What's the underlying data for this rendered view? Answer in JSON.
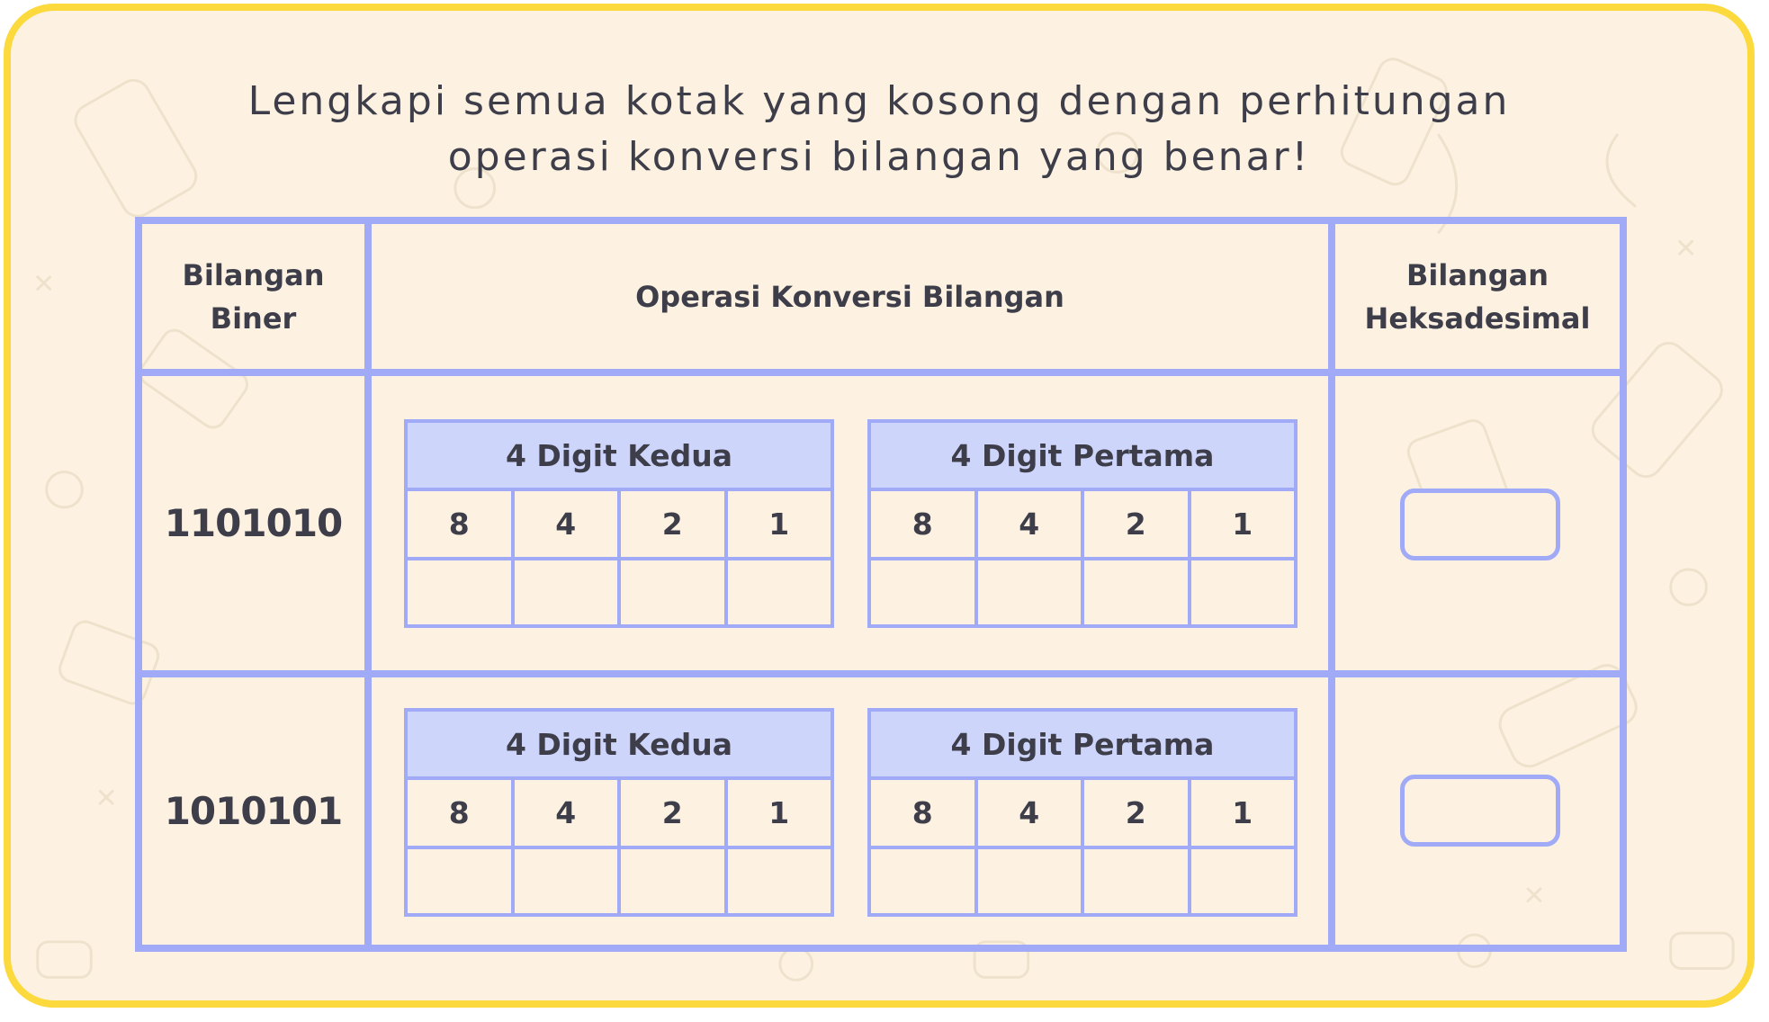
{
  "title": {
    "line1": "Lengkapi semua kotak yang kosong dengan perhitungan",
    "line2": "operasi konversi bilangan yang benar!"
  },
  "headers": {
    "binary_line1": "Bilangan",
    "binary_line2": "Biner",
    "operation": "Operasi Konversi Bilangan",
    "hex_line1": "Bilangan",
    "hex_line2": "Heksadesimal"
  },
  "rows": [
    {
      "binary": "1101010",
      "groups": [
        {
          "title": "4 Digit Kedua",
          "weights": [
            "8",
            "4",
            "2",
            "1"
          ]
        },
        {
          "title": "4 Digit Pertama",
          "weights": [
            "8",
            "4",
            "2",
            "1"
          ]
        }
      ]
    },
    {
      "binary": "1010101",
      "groups": [
        {
          "title": "4 Digit Kedua",
          "weights": [
            "8",
            "4",
            "2",
            "1"
          ]
        },
        {
          "title": "4 Digit Pertama",
          "weights": [
            "8",
            "4",
            "2",
            "1"
          ]
        }
      ]
    }
  ],
  "colors": {
    "frame": "#fcd93d",
    "background": "#fdf2e1",
    "table_border": "#a0aaf6",
    "subheader_fill": "#cdd5fb",
    "text": "#3e3e4a"
  }
}
